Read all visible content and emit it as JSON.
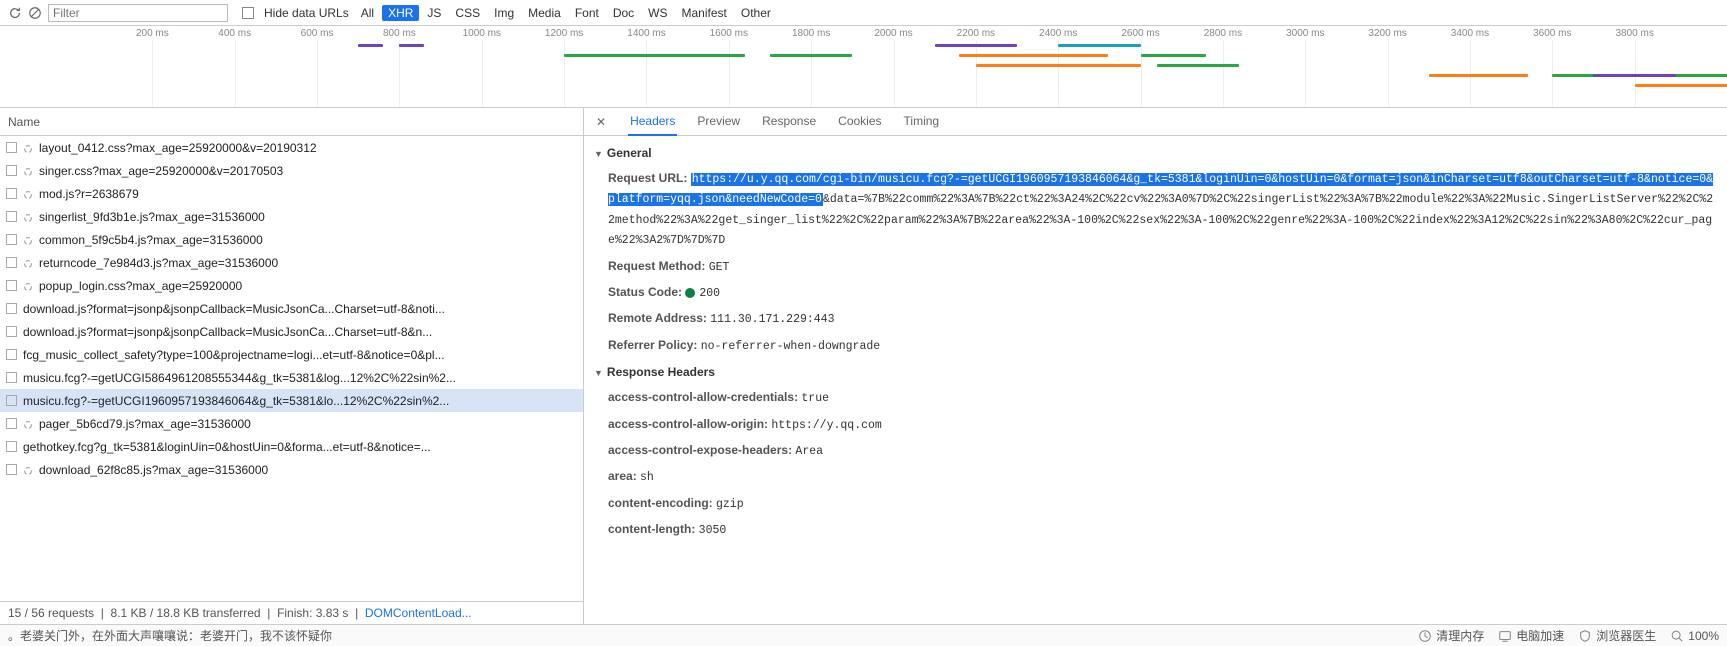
{
  "toolbar": {
    "filter_placeholder": "Filter",
    "hide_data_urls": "Hide data URLs",
    "types": [
      "All",
      "XHR",
      "JS",
      "CSS",
      "Img",
      "Media",
      "Font",
      "Doc",
      "WS",
      "Manifest",
      "Other"
    ],
    "active_type": "XHR"
  },
  "waterfall": {
    "ticks": [
      "200 ms",
      "400 ms",
      "600 ms",
      "800 ms",
      "1000 ms",
      "1200 ms",
      "1400 ms",
      "1600 ms",
      "1800 ms",
      "2000 ms",
      "2200 ms",
      "2400 ms",
      "2600 ms",
      "2800 ms",
      "3000 ms",
      "3200 ms",
      "3400 ms",
      "3600 ms",
      "3800 ms"
    ],
    "bars": [
      {
        "row": 0,
        "start": 3.5,
        "w": 0.3,
        "c": "#6f42c1"
      },
      {
        "row": 0,
        "start": 4.0,
        "w": 0.3,
        "c": "#6f42c1"
      },
      {
        "row": 0,
        "start": 10.5,
        "w": 1.0,
        "c": "#6f42c1"
      },
      {
        "row": 0,
        "start": 12.0,
        "w": 1.0,
        "c": "#17a2b8"
      },
      {
        "row": 1,
        "start": 6.0,
        "w": 2.2,
        "c": "#28a745"
      },
      {
        "row": 1,
        "start": 8.5,
        "w": 1.0,
        "c": "#28a745"
      },
      {
        "row": 1,
        "start": 10.8,
        "w": 1.8,
        "c": "#fd7e14"
      },
      {
        "row": 1,
        "start": 13.0,
        "w": 0.8,
        "c": "#28a745"
      },
      {
        "row": 2,
        "start": 11.0,
        "w": 2.0,
        "c": "#fd7e14"
      },
      {
        "row": 2,
        "start": 13.2,
        "w": 1.0,
        "c": "#28a745"
      },
      {
        "row": 3,
        "start": 16.5,
        "w": 1.2,
        "c": "#fd7e14"
      },
      {
        "row": 3,
        "start": 18.0,
        "w": 2.5,
        "c": "#28a745"
      },
      {
        "row": 3,
        "start": 18.5,
        "w": 1.0,
        "c": "#6f42c1"
      },
      {
        "row": 4,
        "start": 19.0,
        "w": 2.5,
        "c": "#fd7e14"
      },
      {
        "row": 4,
        "start": 21.5,
        "w": 0.8,
        "c": "#28a745"
      },
      {
        "row": 2,
        "start": 25.5,
        "w": 2.0,
        "c": "#fd7e14"
      },
      {
        "row": 2,
        "start": 27.8,
        "w": 2.5,
        "c": "#28a745"
      },
      {
        "row": 2,
        "start": 26.0,
        "w": 0.5,
        "c": "#17a2b8"
      },
      {
        "row": 3,
        "start": 27.0,
        "w": 3.5,
        "c": "#6f42c1"
      },
      {
        "row": 3,
        "start": 30.5,
        "w": 1.0,
        "c": "#28a745"
      }
    ]
  },
  "requests": {
    "header": "Name",
    "items": [
      {
        "name": "layout_0412.css?max_age=25920000&v=20190312",
        "spin": true
      },
      {
        "name": "singer.css?max_age=25920000&v=20170503",
        "spin": true
      },
      {
        "name": "mod.js?r=2638679",
        "spin": true
      },
      {
        "name": "singerlist_9fd3b1e.js?max_age=31536000",
        "spin": true
      },
      {
        "name": "common_5f9c5b4.js?max_age=31536000",
        "spin": true
      },
      {
        "name": "returncode_7e984d3.js?max_age=31536000",
        "spin": true
      },
      {
        "name": "popup_login.css?max_age=25920000",
        "spin": true
      },
      {
        "name": "download.js?format=jsonp&jsonpCallback=MusicJsonCa...Charset=utf-8&noti...",
        "spin": false
      },
      {
        "name": "download.js?format=jsonp&jsonpCallback=MusicJsonCa...Charset=utf-8&n...",
        "spin": false
      },
      {
        "name": "fcg_music_collect_safety?type=100&projectname=logi...et=utf-8&notice=0&pl...",
        "spin": false
      },
      {
        "name": "musicu.fcg?-=getUCGI5864961208555344&g_tk=5381&log...12%2C%22sin%2...",
        "spin": false
      },
      {
        "name": "musicu.fcg?-=getUCGI1960957193846064&g_tk=5381&lo...12%2C%22sin%2...",
        "spin": false,
        "selected": true
      },
      {
        "name": "pager_5b6cd79.js?max_age=31536000",
        "spin": true
      },
      {
        "name": "gethotkey.fcg?g_tk=5381&loginUin=0&hostUin=0&forma...et=utf-8&notice=...",
        "spin": false
      },
      {
        "name": "download_62f8c85.js?max_age=31536000",
        "spin": true
      }
    ],
    "status": {
      "requests": "15 / 56 requests",
      "transferred": "8.1 KB / 18.8 KB transferred",
      "finish": "Finish: 3.83 s",
      "dcl": "DOMContentLoad..."
    }
  },
  "detail": {
    "tabs": [
      "Headers",
      "Preview",
      "Response",
      "Cookies",
      "Timing"
    ],
    "active_tab": "Headers",
    "general": {
      "title": "General",
      "request_url_label": "Request URL:",
      "url_selected": "https://u.y.qq.com/cgi-bin/musicu.fcg?-=getUCGI1960957193846064&g_tk=5381&loginUin=0&hostUin=0&format=json&inCharset=utf8&outCharset=utf-8&notice=0&platform=yqq.json&needNewCode=0",
      "url_rest": "&data=%7B%22comm%22%3A%7B%22ct%22%3A24%2C%22cv%22%3A0%7D%2C%22singerList%22%3A%7B%22module%22%3A%22Music.SingerListServer%22%2C%22method%22%3A%22get_singer_list%22%2C%22param%22%3A%7B%22area%22%3A-100%2C%22sex%22%3A-100%2C%22genre%22%3A-100%2C%22index%22%3A12%2C%22sin%22%3A80%2C%22cur_page%22%3A2%7D%7D%7D",
      "request_method_label": "Request Method:",
      "request_method": "GET",
      "status_code_label": "Status Code:",
      "status_code": "200",
      "remote_address_label": "Remote Address:",
      "remote_address": "111.30.171.229:443",
      "referrer_policy_label": "Referrer Policy:",
      "referrer_policy": "no-referrer-when-downgrade"
    },
    "response_headers": {
      "title": "Response Headers",
      "items": [
        {
          "k": "access-control-allow-credentials:",
          "v": "true"
        },
        {
          "k": "access-control-allow-origin:",
          "v": "https://y.qq.com"
        },
        {
          "k": "access-control-expose-headers:",
          "v": "Area"
        },
        {
          "k": "area:",
          "v": "sh"
        },
        {
          "k": "content-encoding:",
          "v": "gzip"
        },
        {
          "k": "content-length:",
          "v": "3050"
        }
      ]
    }
  },
  "footer": {
    "left_text": "。老婆关门外，在外面大声嚷嚷说：老婆开门，我不该怀疑你",
    "btns": [
      "清理内存",
      "电脑加速",
      "浏览器医生"
    ],
    "zoom": "100%"
  }
}
